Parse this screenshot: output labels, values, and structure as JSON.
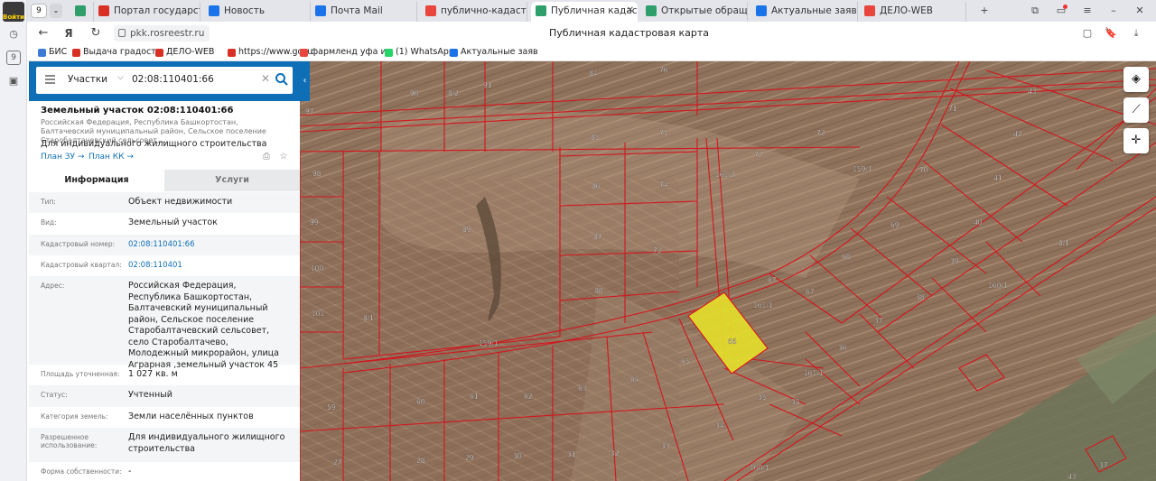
{
  "browser": {
    "profile_label": "Войти",
    "tab_count": "9",
    "tabs": [
      {
        "label": "Портал государственн",
        "color": "#d93025"
      },
      {
        "label": "Новость",
        "color": "#1a73e8"
      },
      {
        "label": "Почта Mail",
        "color": "#1a73e8"
      },
      {
        "label": "публично-кадастрова",
        "color": "#e8453c"
      },
      {
        "label": "Публичная кадастро",
        "color": "#2e9e6b"
      },
      {
        "label": "Открытые обращения",
        "color": "#2e9e6b"
      },
      {
        "label": "Актуальные заявления",
        "color": "#1a73e8"
      },
      {
        "label": "ДЕЛО-WEB",
        "color": "#e8453c"
      }
    ],
    "url": "pkk.rosreestr.ru",
    "page_title": "Публичная кадастровая карта",
    "bookmarks": [
      {
        "label": "БИС",
        "color": "#3e7bd4"
      },
      {
        "label": "Выдача градостр",
        "color": "#d93025"
      },
      {
        "label": "ДЕЛО-WEB",
        "color": "#d93025"
      },
      {
        "label": "https://www.gosu",
        "color": "#d93025"
      },
      {
        "label": "фармленд уфа и",
        "color": "#e8453c"
      },
      {
        "label": "(1) WhatsApp",
        "color": "#25d366"
      },
      {
        "label": "Актуальные заяв",
        "color": "#1a73e8"
      }
    ]
  },
  "search": {
    "category": "Участки",
    "query": "02:08:110401:66"
  },
  "object": {
    "title": "Земельный участок 02:08:110401:66",
    "short_address": "Российская Федерация, Республика Башкортостан, Балтачевский муниципальный район, Сельское поселение Старобалтачевский сельсовет,...",
    "purpose": "Для индивидуального жилищного строительства",
    "links": [
      "План ЗУ →",
      "План КК →"
    ]
  },
  "info_tabs": {
    "info": "Информация",
    "services": "Услуги"
  },
  "info_rows": [
    {
      "label": "Тип:",
      "value": "Объект недвижимости",
      "link": false
    },
    {
      "label": "Вид:",
      "value": "Земельный участок",
      "link": false
    },
    {
      "label": "Кадастровый номер:",
      "value": "02:08:110401:66",
      "link": true
    },
    {
      "label": "Кадастровый квартал:",
      "value": "02:08:110401",
      "link": true
    },
    {
      "label": "Адрес:",
      "value": "Российская Федерация, Республика Башкортостан, Балтачевский муниципальный район, Сельское поселение Старобалтачевский сельсовет, село Старобалтачево, Молодежный микрорайон, улица Аграрная ,земельный участок 45",
      "link": false
    },
    {
      "label": "Площадь уточненная:",
      "value": "1 027 кв. м",
      "link": false
    },
    {
      "label": "Статус:",
      "value": "Учтенный",
      "link": false
    },
    {
      "label": "Категория земель:",
      "value": "Земли населённых пунктов",
      "link": false
    },
    {
      "label": "Разрешенное использование:",
      "value": "Для индивидуального жилищного строительства",
      "link": false
    },
    {
      "label": "Форма собственности:",
      "value": "-",
      "link": false
    }
  ],
  "map": {
    "highlight_color": "#e6e02a",
    "boundary_color": "#d4151d",
    "parcel_labels": [
      "84",
      "76",
      "90",
      "8/2",
      "91",
      "43",
      "97",
      "71",
      "42",
      "85",
      "75",
      "72",
      "72",
      "159/1",
      "70",
      "41",
      "98",
      "86",
      "74",
      "161/2",
      "69",
      "40",
      "99",
      "87",
      "73",
      "68",
      "39",
      "8/1",
      "89",
      "100",
      "88",
      "67",
      "67",
      "160/1",
      "38",
      "101",
      "8/1",
      "161/1",
      "37",
      "159/1",
      "66",
      "36",
      "65",
      "64",
      "63",
      "62",
      "61",
      "60",
      "59",
      "35",
      "35",
      "161/1",
      "34",
      "33",
      "32",
      "31",
      "30",
      "29",
      "28",
      "27",
      "160/1",
      "43",
      "37"
    ]
  }
}
